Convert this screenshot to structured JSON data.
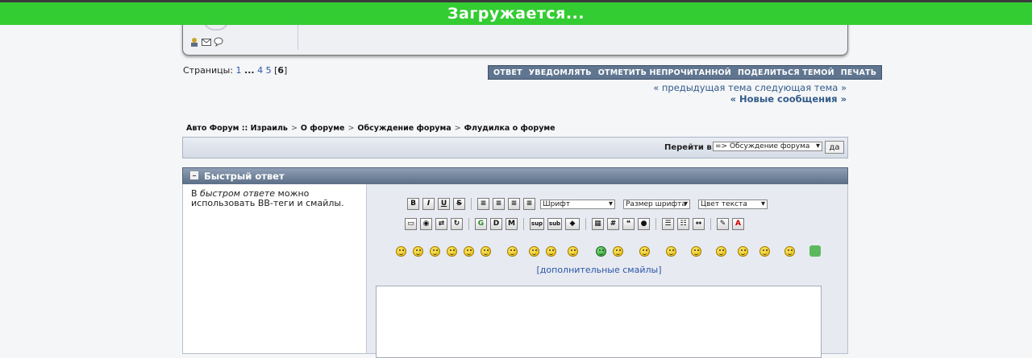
{
  "loading": {
    "text": "Загружается..."
  },
  "pagination": {
    "label": "Страницы:",
    "pages": [
      "1",
      "...",
      "4",
      "5"
    ],
    "current": "6"
  },
  "actions": [
    "ОТВЕТ",
    "УВЕДОМЛЯТЬ",
    "ОТМЕТИТЬ НЕПРОЧИТАННОЙ",
    "ПОДЕЛИТЬСЯ ТЕМОЙ",
    "ПЕЧАТЬ"
  ],
  "topic_nav": {
    "prev_next": "« предыдущая тема следующая тема »",
    "new_messages": "« Новые сообщения »"
  },
  "breadcrumb": [
    "Авто Форум :: Израиль",
    "О форуме",
    "Обсуждение форума",
    "Флудилка о форуме"
  ],
  "breadcrumb_sep": ">",
  "jump": {
    "label": "Перейти в:",
    "selected": "=> Обсуждение форума",
    "button": "да"
  },
  "quick_reply": {
    "title": "Быстрый ответ",
    "note_pre": "В ",
    "note_em": "быстром ответе",
    "note_post": " можно использовать BB-теги и смайлы.",
    "font_select": "Шрифт",
    "size_select": "Размер шрифта",
    "color_select": "Цвет текста",
    "more_smilies": "[дополнительные смайлы]"
  },
  "toolbar": {
    "bold": "B",
    "italic": "I",
    "underline": "U",
    "strike": "S",
    "google": "G",
    "sup": "sup",
    "sub": "sub",
    "hash": "#",
    "font_color": "A"
  },
  "colors": {
    "loading_bg": "#33cc33",
    "action_bar": "#5f7590",
    "link": "#2a55a8"
  }
}
